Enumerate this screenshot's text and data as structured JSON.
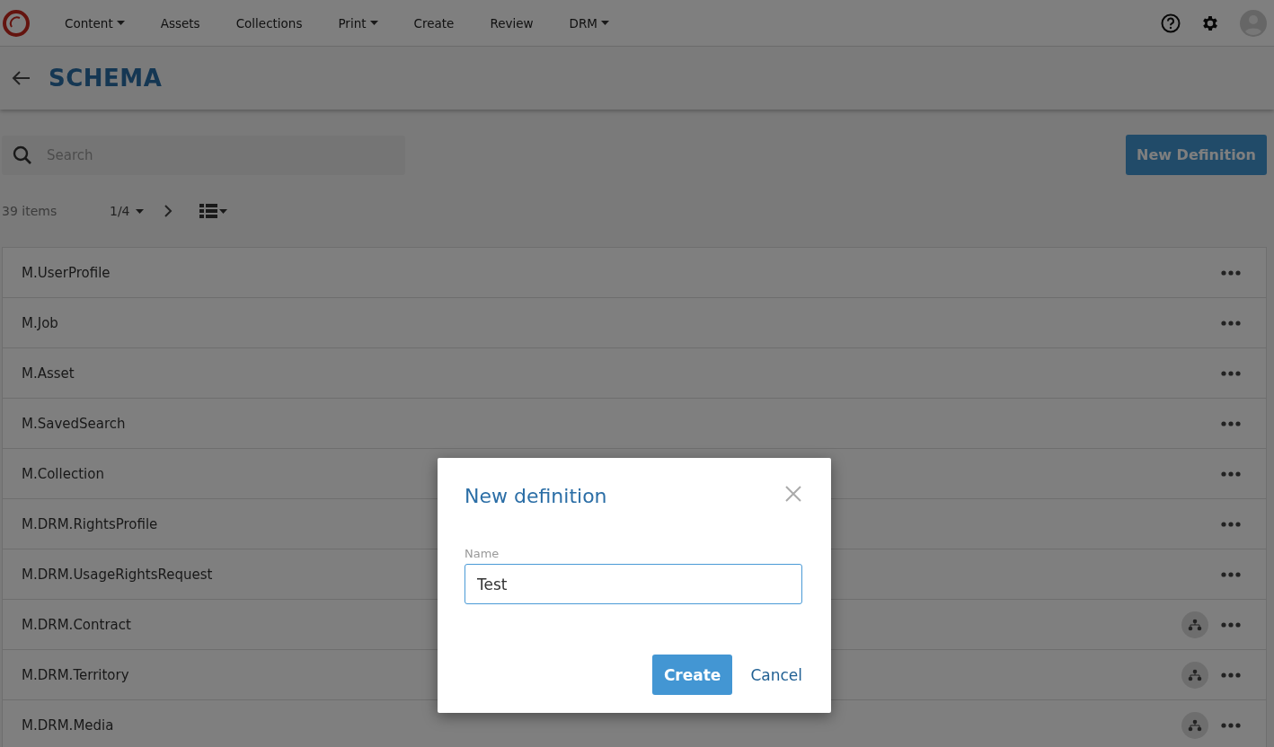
{
  "nav": {
    "items": [
      {
        "label": "Content",
        "dropdown": true
      },
      {
        "label": "Assets",
        "dropdown": false
      },
      {
        "label": "Collections",
        "dropdown": false
      },
      {
        "label": "Print",
        "dropdown": true
      },
      {
        "label": "Create",
        "dropdown": false
      },
      {
        "label": "Review",
        "dropdown": false
      },
      {
        "label": "DRM",
        "dropdown": true
      }
    ]
  },
  "header": {
    "title": "SCHEMA"
  },
  "search": {
    "placeholder": "Search"
  },
  "new_button": "New Definition",
  "toolbar": {
    "count": "39 items",
    "page": "1/4"
  },
  "rows": [
    {
      "name": "M.UserProfile",
      "hierarchy": false
    },
    {
      "name": "M.Job",
      "hierarchy": false
    },
    {
      "name": "M.Asset",
      "hierarchy": false
    },
    {
      "name": "M.SavedSearch",
      "hierarchy": false
    },
    {
      "name": "M.Collection",
      "hierarchy": false
    },
    {
      "name": "M.DRM.RightsProfile",
      "hierarchy": false
    },
    {
      "name": "M.DRM.UsageRightsRequest",
      "hierarchy": false
    },
    {
      "name": "M.DRM.Contract",
      "hierarchy": true
    },
    {
      "name": "M.DRM.Territory",
      "hierarchy": true
    },
    {
      "name": "M.DRM.Media",
      "hierarchy": true
    }
  ],
  "dialog": {
    "title": "New definition",
    "field_label": "Name",
    "field_value": "Test",
    "buttons": [
      "Create",
      "Cancel"
    ]
  }
}
